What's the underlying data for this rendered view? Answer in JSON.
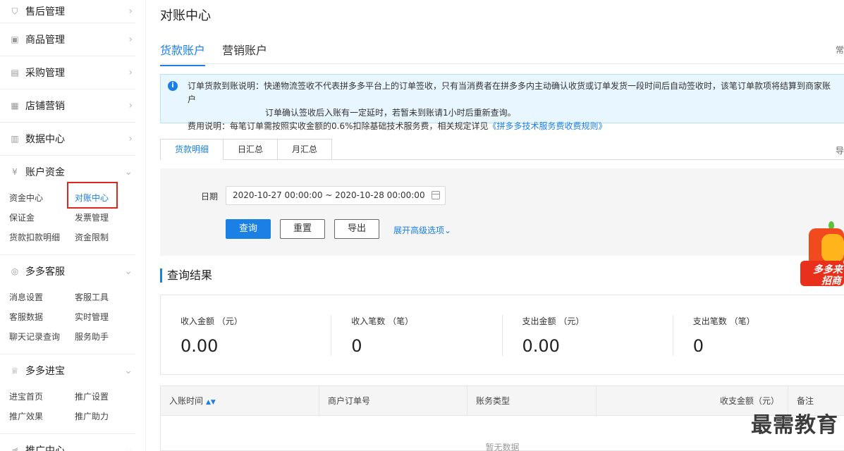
{
  "sidebar": {
    "groups": [
      {
        "label": "售后管理",
        "icon": "shield-icon"
      },
      {
        "label": "商品管理",
        "icon": "bag-icon"
      },
      {
        "label": "采购管理",
        "icon": "list-icon"
      },
      {
        "label": "店铺营销",
        "icon": "calendar-icon"
      },
      {
        "label": "数据中心",
        "icon": "bar-chart-icon"
      },
      {
        "label": "账户资金",
        "icon": "yen-icon",
        "items": [
          "资金中心",
          "对账中心",
          "保证金",
          "发票管理",
          "货款扣款明细",
          "资金限制"
        ],
        "active": "对账中心"
      },
      {
        "label": "多多客服",
        "icon": "headset-icon",
        "items": [
          "消息设置",
          "客服工具",
          "客服数据",
          "实时管理",
          "聊天记录查询",
          "服务助手"
        ]
      },
      {
        "label": "多多进宝",
        "icon": "treasure-icon",
        "items": [
          "进宝首页",
          "推广设置",
          "推广效果",
          "推广助力"
        ]
      },
      {
        "label": "推广中心",
        "icon": "share-icon"
      }
    ]
  },
  "page": {
    "title": "对账中心",
    "tabs": [
      "货款账户",
      "营销账户"
    ],
    "active_tab": "货款账户",
    "top_right": "常"
  },
  "notice": {
    "line1": "订单货款到账说明：快递物流签收不代表拼多多平台上的订单签收，只有当消费者在拼多多内主动确认收货或订单发货一段时间后自动签收时，该笔订单款项将结算到商家账户",
    "line2": "订单确认签收后入账有一定延时，若暂未到账请1小时后重新查询。",
    "line3_prefix": "费用说明：每笔订单需按照实收金额的0.6%扣除基础技术服务费，相关规定详见",
    "line3_link": "《拼多多技术服务费收费规则》"
  },
  "sub_tabs": [
    "货款明细",
    "日汇总",
    "月汇总"
  ],
  "sub_right": "导",
  "filter": {
    "date_label": "日期",
    "date_value": "2020-10-27 00:00:00 ~ 2020-10-28 00:00:00",
    "query_button": "查询",
    "reset_button": "重置",
    "export_button": "导出",
    "advanced_link": "展开高级选项"
  },
  "results": {
    "title": "查询结果",
    "stats": [
      {
        "label": "收入金额 （元）",
        "value": "0.00"
      },
      {
        "label": "收入笔数 （笔）",
        "value": "0"
      },
      {
        "label": "支出金额 （元）",
        "value": "0.00"
      },
      {
        "label": "支出笔数 （笔）",
        "value": "0"
      }
    ]
  },
  "table": {
    "headers": [
      "入账时间",
      "商户订单号",
      "账务类型",
      "收支金额（元）",
      "备注"
    ],
    "empty_text": "暂无数据"
  },
  "promo": {
    "line1": "多多来",
    "line2": "招商"
  },
  "watermark": "最需教育",
  "colors": {
    "accent": "#1a80e6",
    "highlight_box": "#d9281e",
    "notice_bg": "#e8f6ff"
  }
}
